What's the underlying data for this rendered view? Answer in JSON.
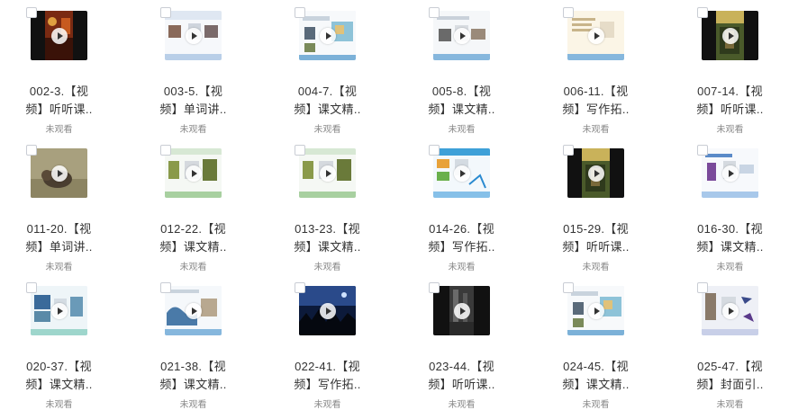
{
  "items": [
    {
      "title_l1": "002-3.【视",
      "title_l2": "频】听听课..",
      "status": "未观看",
      "thumb": "dark-game"
    },
    {
      "title_l1": "003-5.【视",
      "title_l2": "频】单词讲..",
      "status": "未观看",
      "thumb": "slide-people"
    },
    {
      "title_l1": "004-7.【视",
      "title_l2": "频】课文精..",
      "status": "未观看",
      "thumb": "slide-map"
    },
    {
      "title_l1": "005-8.【视",
      "title_l2": "频】课文精..",
      "status": "未观看",
      "thumb": "slide-photo"
    },
    {
      "title_l1": "006-11.【视",
      "title_l2": "频】写作拓..",
      "status": "未观看",
      "thumb": "slide-paper"
    },
    {
      "title_l1": "007-14.【视",
      "title_l2": "频】听听课..",
      "status": "未观看",
      "thumb": "dark-book"
    },
    {
      "title_l1": "011-20.【视",
      "title_l2": "频】单词讲..",
      "status": "未观看",
      "thumb": "animal-photo"
    },
    {
      "title_l1": "012-22.【视",
      "title_l2": "频】课文精..",
      "status": "未观看",
      "thumb": "slide-nature"
    },
    {
      "title_l1": "013-23.【视",
      "title_l2": "频】课文精..",
      "status": "未观看",
      "thumb": "slide-nature"
    },
    {
      "title_l1": "014-26.【视",
      "title_l2": "频】写作拓..",
      "status": "未观看",
      "thumb": "slide-colorful"
    },
    {
      "title_l1": "015-29.【视",
      "title_l2": "频】听听课..",
      "status": "未观看",
      "thumb": "dark-book"
    },
    {
      "title_l1": "016-30.【视",
      "title_l2": "频】课文精..",
      "status": "未观看",
      "thumb": "slide-person"
    },
    {
      "title_l1": "020-37.【视",
      "title_l2": "频】课文精..",
      "status": "未观看",
      "thumb": "slide-ice"
    },
    {
      "title_l1": "021-38.【视",
      "title_l2": "频】课文精..",
      "status": "未观看",
      "thumb": "slide-wave"
    },
    {
      "title_l1": "022-41.【视",
      "title_l2": "频】写作拓..",
      "status": "未观看",
      "thumb": "dark-night"
    },
    {
      "title_l1": "023-44.【视",
      "title_l2": "频】听听课..",
      "status": "未观看",
      "thumb": "dark-forest"
    },
    {
      "title_l1": "024-45.【视",
      "title_l2": "频】课文精..",
      "status": "未观看",
      "thumb": "slide-map"
    },
    {
      "title_l1": "025-47.【视",
      "title_l2": "频】封面引..",
      "status": "未观看",
      "thumb": "slide-cover"
    }
  ]
}
